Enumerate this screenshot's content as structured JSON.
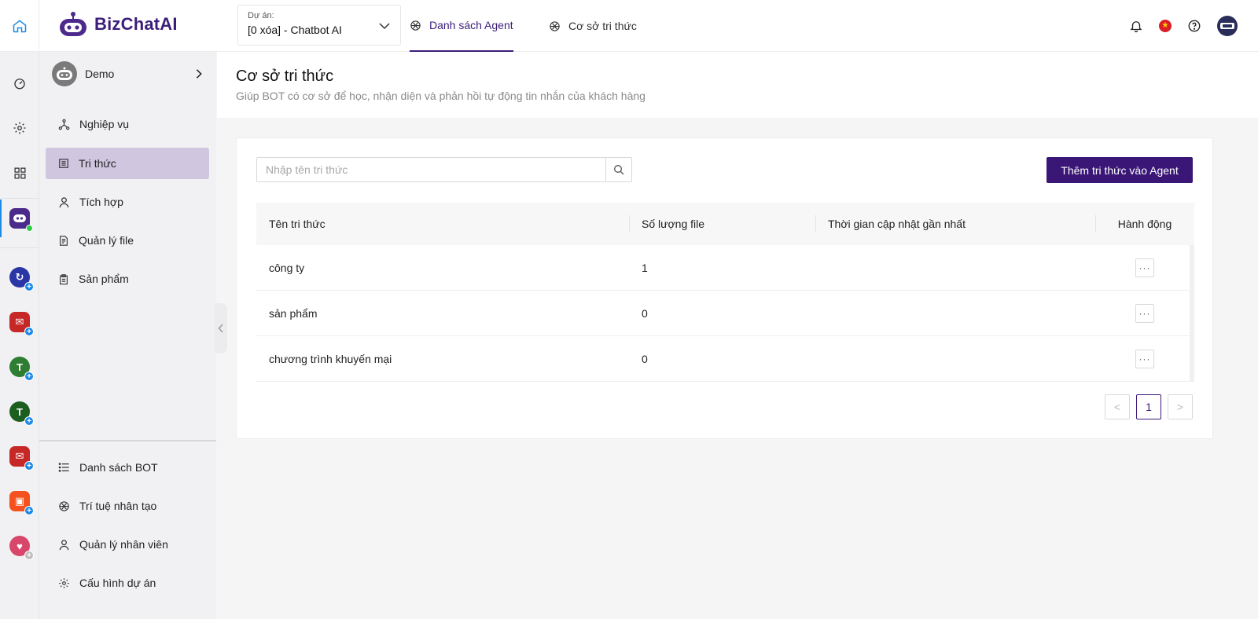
{
  "header": {
    "logo_text": "BizChatAI",
    "project_label": "Dự án:",
    "project_value": "[0 xóa] - Chatbot AI",
    "tabs": [
      {
        "label": "Danh sách Agent",
        "active": true
      },
      {
        "label": "Cơ sở tri thức",
        "active": false
      }
    ]
  },
  "rail": {
    "apps": [
      {
        "name": "bizchat",
        "color": "#4b2a8c"
      },
      {
        "name": "app-blue",
        "color": "#2a35a6"
      },
      {
        "name": "mail-red",
        "color": "#c62828"
      },
      {
        "name": "app-green",
        "color": "#2e7d32"
      },
      {
        "name": "app-green-2",
        "color": "#1b5e20"
      },
      {
        "name": "mail-red-2",
        "color": "#c62828"
      },
      {
        "name": "shop-orange",
        "color": "#f4511e"
      },
      {
        "name": "app-pink",
        "color": "#d8476b"
      }
    ]
  },
  "sidebar": {
    "bot_name": "Demo",
    "items": [
      {
        "label": "Nghiệp vụ",
        "icon": "network-icon",
        "active": false
      },
      {
        "label": "Tri thức",
        "icon": "book-icon",
        "active": true
      },
      {
        "label": "Tích hợp",
        "icon": "user-icon",
        "active": false
      },
      {
        "label": "Quản lý file",
        "icon": "file-icon",
        "active": false
      },
      {
        "label": "Sản phẩm",
        "icon": "clipboard-icon",
        "active": false
      }
    ],
    "bottom_items": [
      {
        "label": "Danh sách BOT",
        "icon": "list-icon"
      },
      {
        "label": "Trí tuệ nhân tạo",
        "icon": "ai-icon"
      },
      {
        "label": "Quản lý nhân viên",
        "icon": "user-icon"
      },
      {
        "label": "Cấu hình dự án",
        "icon": "gear-icon"
      }
    ]
  },
  "page": {
    "title": "Cơ sở tri thức",
    "subtitle": "Giúp BOT có cơ sở để học, nhận diện và phản hồi tự động tin nhắn của khách hàng"
  },
  "search": {
    "placeholder": "Nhập tên tri thức",
    "value": ""
  },
  "add_button_label": "Thêm tri thức vào Agent",
  "table": {
    "columns": [
      "Tên tri thức",
      "Số lượng file",
      "Thời gian cập nhật gần nhất",
      "Hành động"
    ],
    "rows": [
      {
        "name": "công ty",
        "file_count": "1",
        "updated": ""
      },
      {
        "name": "sản phẩm",
        "file_count": "0",
        "updated": ""
      },
      {
        "name": "chương trình khuyến mại",
        "file_count": "0",
        "updated": ""
      }
    ],
    "action_label": "···"
  },
  "pagination": {
    "current_page": "1",
    "prev": "<",
    "next": ">"
  },
  "colors": {
    "brand": "#3a1777",
    "active_nav": "#d0c6df",
    "accent_blue": "#1e88e5"
  }
}
